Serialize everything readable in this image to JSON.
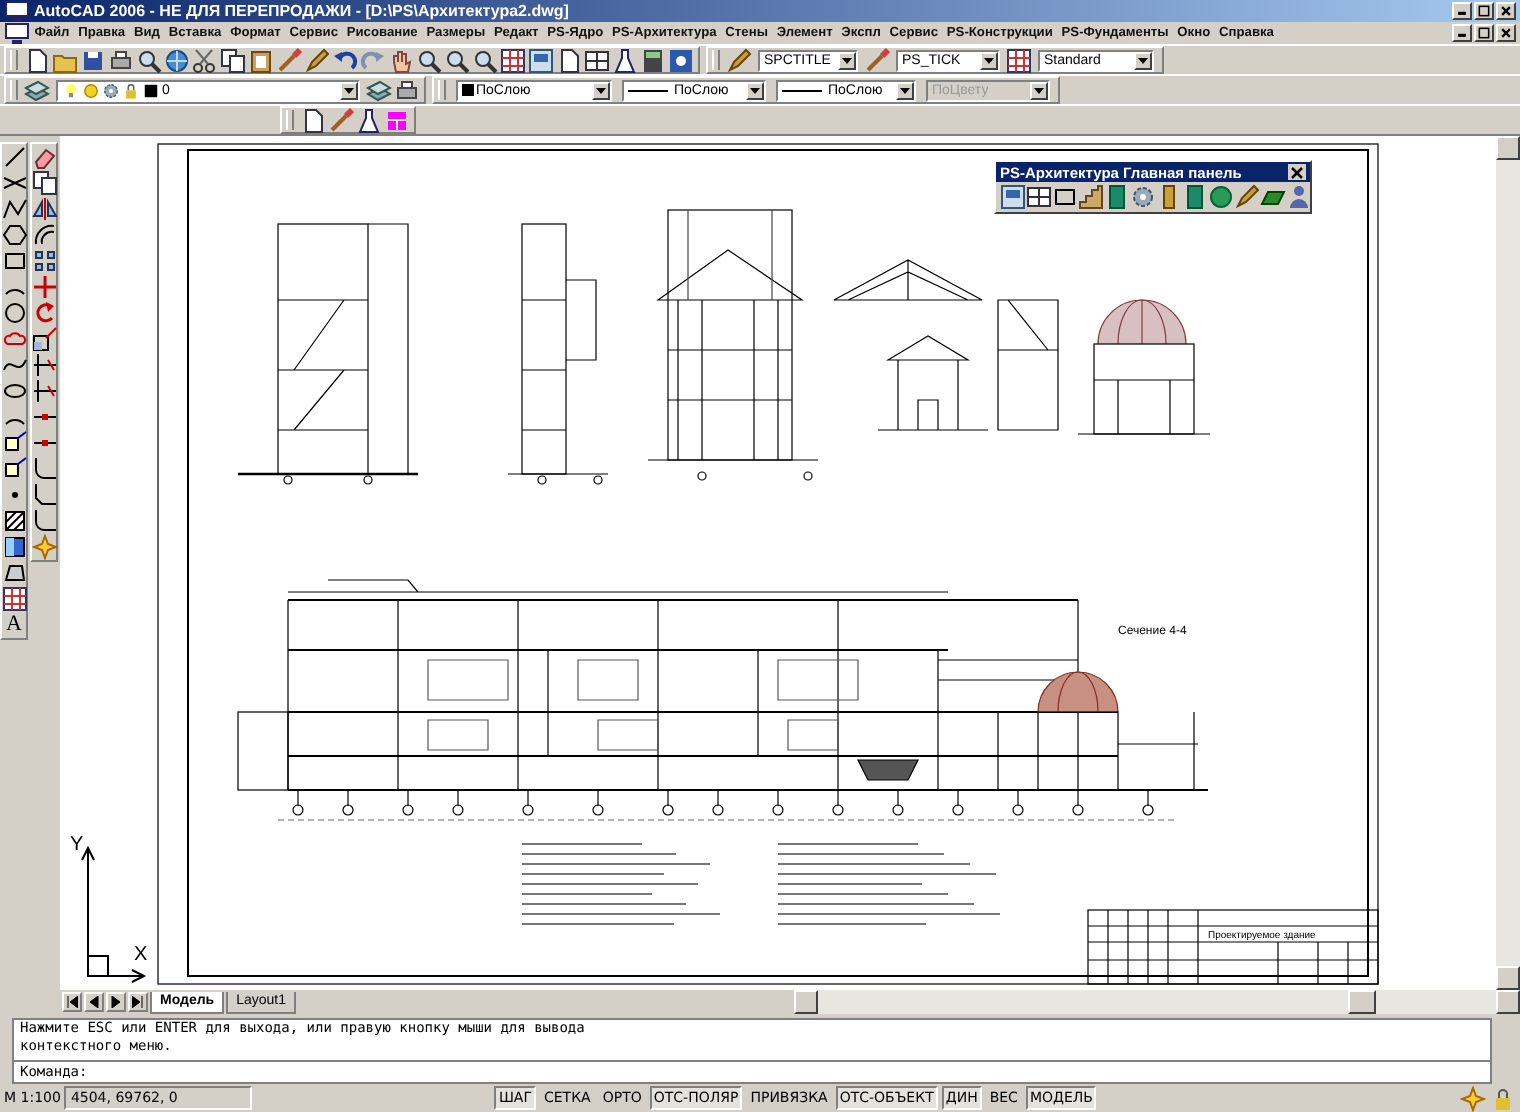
{
  "window": {
    "title": "AutoCAD 2006 - НЕ ДЛЯ ПЕРЕПРОДАЖИ - [D:\\PS\\Архитектура2.dwg]"
  },
  "menu": [
    "Файл",
    "Правка",
    "Вид",
    "Вставка",
    "Формат",
    "Сервис",
    "Рисование",
    "Размеры",
    "Редакт",
    "PS-Ядро",
    "PS-Архитектура",
    "Стены",
    "Элемент",
    "Экспл",
    "Сервис",
    "PS-Конструкции",
    "PS-Фундаменты",
    "Окно",
    "Справка"
  ],
  "styles": {
    "text_style": "SPCTITLE",
    "dim_style": "PS_TICK",
    "table_style": "Standard"
  },
  "layers": {
    "current": "0"
  },
  "properties": [
    {
      "value": "ПоСлою",
      "kind": "color",
      "disabled": false
    },
    {
      "value": "ПоСлою",
      "kind": "linetype",
      "disabled": false
    },
    {
      "value": "ПоСлою",
      "kind": "linetype",
      "disabled": false
    },
    {
      "value": "ПоЦвету",
      "kind": "plain",
      "disabled": true
    }
  ],
  "palette": {
    "title": "PS-Архитектура Главная панель"
  },
  "left_toolbar": {
    "text_tool": "A"
  },
  "drawing": {
    "labels": [
      {
        "text": "Сечение 4-4",
        "kind": "section"
      },
      {
        "text": "Проектируемое здание",
        "kind": "title"
      }
    ]
  },
  "ucs": {
    "y": "Y",
    "x": "X"
  },
  "tabs": [
    {
      "label": "Модель",
      "selected": true
    },
    {
      "label": "Layout1",
      "selected": false
    }
  ],
  "command": {
    "history": "Нажмите ESC или ENTER для выхода, или правую кнопку мыши для вывода контекстного меню.",
    "prompt": "Команда:"
  },
  "status_bar": {
    "scale": "М 1:100",
    "coordinates": "4504, 69762, 0",
    "toggles": [
      {
        "label": "ШАГ",
        "on": true
      },
      {
        "label": "СЕТКА",
        "on": false
      },
      {
        "label": "ОРТО",
        "on": false
      },
      {
        "label": "ОТС-ПОЛЯР",
        "on": true
      },
      {
        "label": "ПРИВЯЗКА",
        "on": false
      },
      {
        "label": "ОТС-ОБЪЕКТ",
        "on": true
      },
      {
        "label": "ДИН",
        "on": true
      },
      {
        "label": "ВЕС",
        "on": false
      },
      {
        "label": "МОДЕЛЬ",
        "on": true
      }
    ]
  }
}
